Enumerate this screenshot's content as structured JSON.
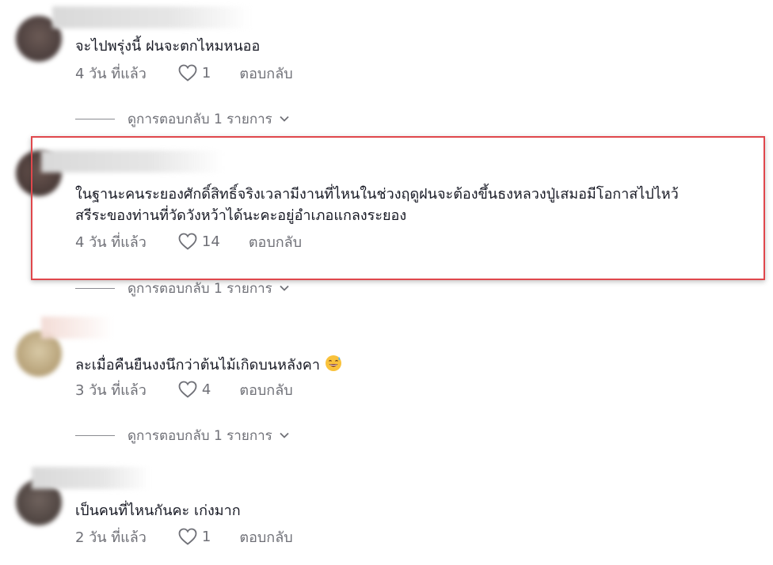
{
  "comments": [
    {
      "text_lines": [
        "จะไปพรุ่งนี้ ฝนจะตกไหมหนออ"
      ],
      "time": "4 วัน ที่แล้ว",
      "likes": "1",
      "reply_label": "ตอบกลับ",
      "view_replies": "ดูการตอบกลับ 1 รายการ"
    },
    {
      "text_lines": [
        "ในฐานะคนระยองศักดิ์สิทธิ์จริงเวลามีงานที่ไหนในช่วงฤดูฝนจะต้องขึ้นธงหลวงปู่เสมอมีโอกาสไปไหว้",
        "สรีระของท่านที่วัดวังหว้าได้นะคะอยู่อำเภอแกลงระยอง"
      ],
      "time": "4 วัน ที่แล้ว",
      "likes": "14",
      "reply_label": "ตอบกลับ",
      "view_replies": "ดูการตอบกลับ 1 รายการ"
    },
    {
      "text_lines": [
        "ละเมื่อคืนยืนงงนึกว่าต้นไม้เกิดบนหลังคา"
      ],
      "time": "3 วัน ที่แล้ว",
      "likes": "4",
      "reply_label": "ตอบกลับ",
      "view_replies": "ดูการตอบกลับ 1 รายการ"
    },
    {
      "text_lines": [
        "เป็นคนที่ไหนกันคะ เก่งมาก"
      ],
      "time": "2 วัน ที่แล้ว",
      "likes": "1",
      "reply_label": "ตอบกลับ"
    }
  ],
  "icons": {
    "like": "heart-outline-icon",
    "expand": "chevron-down-icon",
    "emoji": "sweat-smile-emoji"
  },
  "colors": {
    "text": "#161823",
    "meta": "#6f7077",
    "highlight_border": "#e0474c"
  }
}
